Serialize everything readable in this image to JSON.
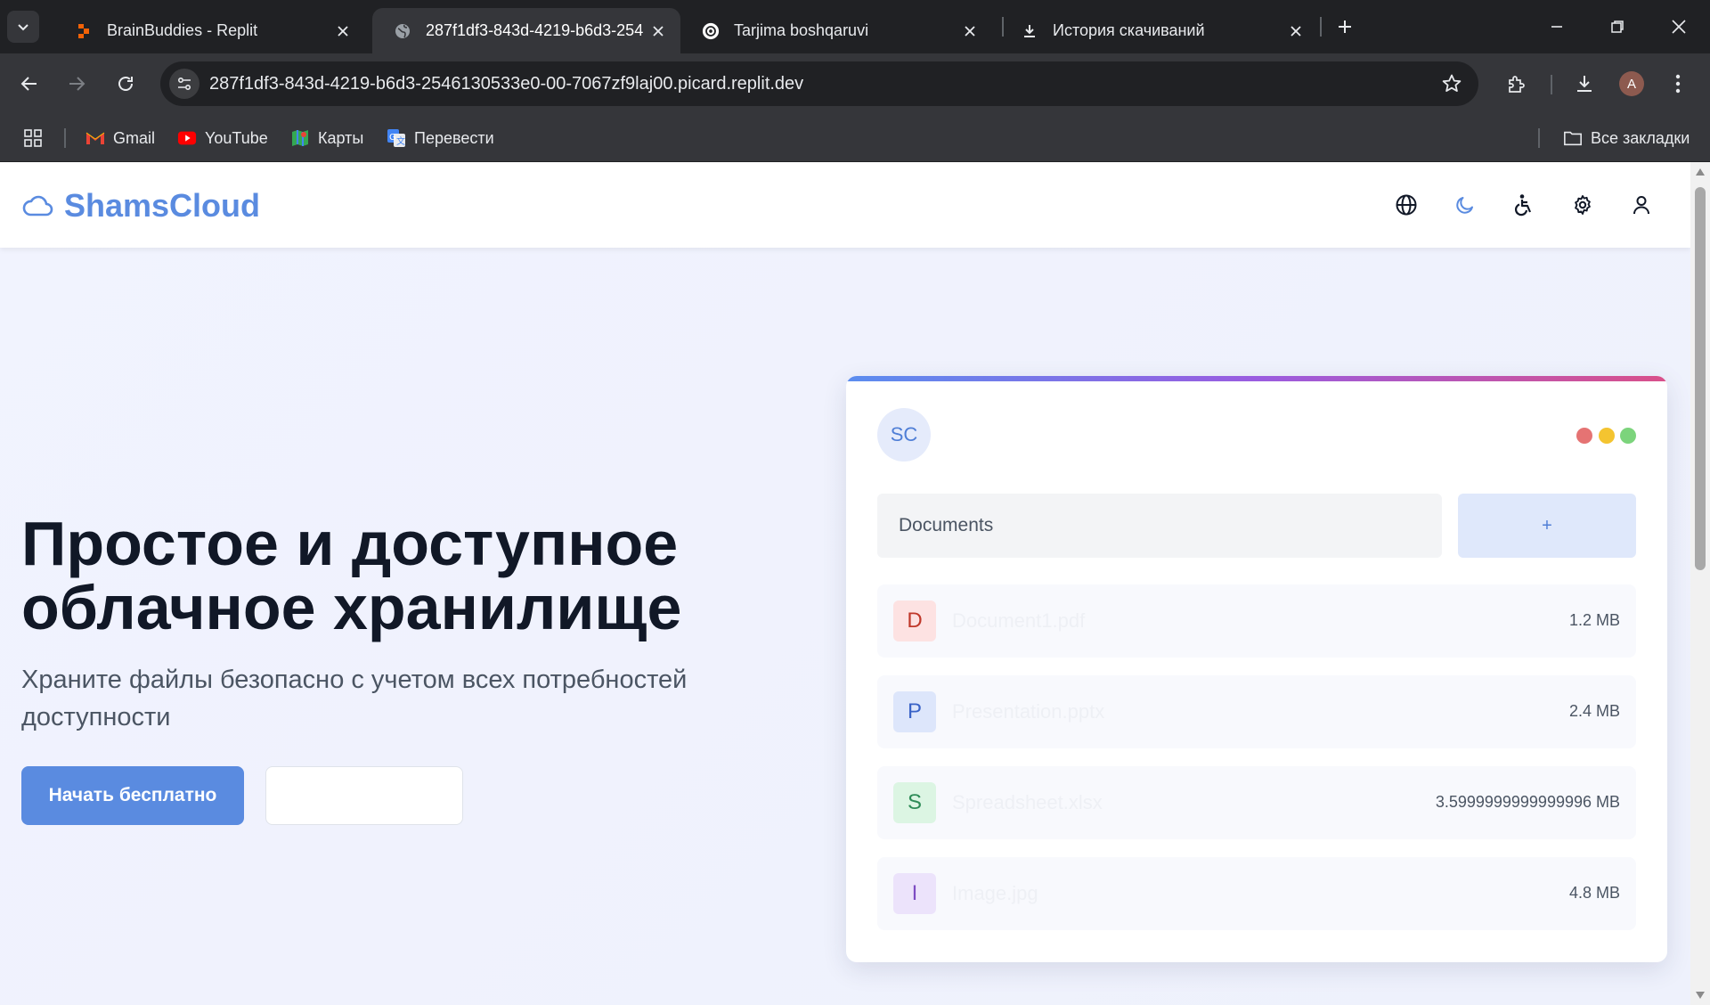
{
  "browser": {
    "tabs": [
      {
        "title": "BrainBuddies - Replit",
        "favicon": "replit-icon"
      },
      {
        "title": "287f1df3-843d-4219-b6d3-254",
        "favicon": "globe-icon",
        "active": true
      },
      {
        "title": "Tarjima boshqaruvi",
        "favicon": "openai-icon"
      },
      {
        "title": "История скачиваний",
        "favicon": "download-icon"
      }
    ],
    "url": "287f1df3-843d-4219-b6d3-2546130533e0-00-7067zf9laj00.picard.replit.dev",
    "profile_initial": "A",
    "bookmarks": [
      {
        "label": "Gmail",
        "icon": "gmail-icon"
      },
      {
        "label": "YouTube",
        "icon": "youtube-icon"
      },
      {
        "label": "Карты",
        "icon": "maps-icon"
      },
      {
        "label": "Перевести",
        "icon": "translate-icon"
      }
    ],
    "all_bookmarks_label": "Все закладки"
  },
  "app": {
    "brand": "ShamsCloud",
    "accent_color": "#5a8be0",
    "nav_icons": [
      "globe-icon",
      "moon-icon",
      "accessibility-icon",
      "gear-icon",
      "user-icon"
    ]
  },
  "hero": {
    "title_line1": "Простое и доступное",
    "title_line2": "облачное хранилище",
    "subtitle": "Храните файлы безопасно с учетом всех потребностей доступности",
    "primary_button": "Начать бесплатно",
    "secondary_button": ""
  },
  "preview": {
    "avatar": "SC",
    "window_dots": [
      "#e57373",
      "#f4c430",
      "#7cd47c"
    ],
    "folder_value": "Documents",
    "add_label": "+",
    "files": [
      {
        "letter": "D",
        "name": "Document1.pdf",
        "size": "1.2 MB"
      },
      {
        "letter": "P",
        "name": "Presentation.pptx",
        "size": "2.4 MB"
      },
      {
        "letter": "S",
        "name": "Spreadsheet.xlsx",
        "size": "3.5999999999999996 MB"
      },
      {
        "letter": "I",
        "name": "Image.jpg",
        "size": "4.8 MB"
      }
    ]
  }
}
